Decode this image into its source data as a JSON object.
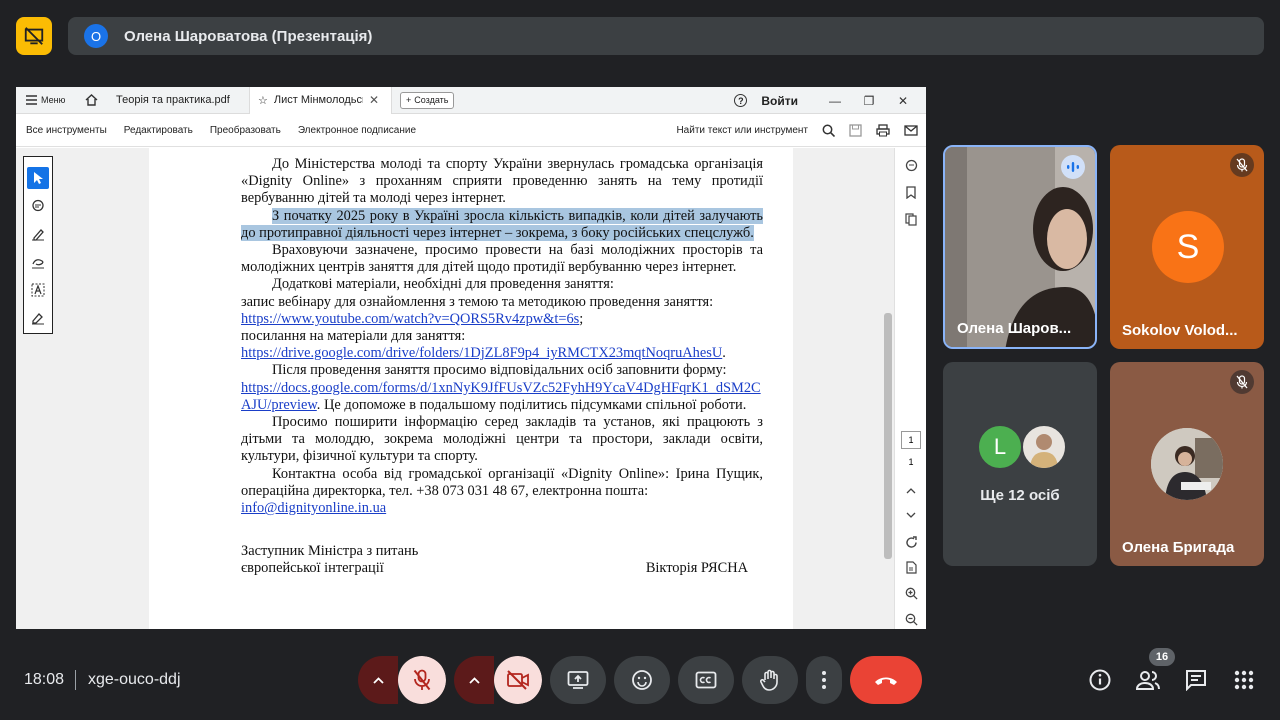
{
  "presenter": {
    "avatar_letter": "О",
    "title": "Олена Шароватова (Презентація)",
    "stop_icon": "presentation-off-icon"
  },
  "reader": {
    "menu_label": "Меню",
    "tabs": [
      {
        "label": "Теорія та практика.pdf"
      },
      {
        "label": "Лист Мінмолодьспо..."
      }
    ],
    "create_label": "Создать",
    "signin_label": "Войти",
    "toolbar": {
      "all_tools": "Все инструменты",
      "edit": "Редактировать",
      "convert": "Преобразовать",
      "esign": "Электронное подписание",
      "find": "Найти текст или инструмент"
    },
    "page_current": "1",
    "page_total": "1"
  },
  "doc": {
    "p1": "До Міністерства молоді та спорту України звернулась громадська організація «Dignity Online» з проханням сприяти проведенню занять на тему протидії вербуванню дітей та молоді через інтернет.",
    "p2": "З початку 2025 року в Україні зросла кількість випадків, коли дітей залучають до протиправної діяльності через інтернет – зокрема, з боку російських спецслужб.",
    "p3": "Враховуючи зазначене, просимо провести на базі молодіжних просторів та молодіжних центрів заняття для дітей щодо протидії вербуванню через інтернет.",
    "p4": "Додаткові матеріали, необхідні для проведення заняття:",
    "p5": "запис вебінару для ознайомлення з темою та методикою проведення заняття:",
    "link1": "https://www.youtube.com/watch?v=QORS5Rv4zpw&t=6s",
    "p5_end": ";",
    "p6": "посилання на матеріали для заняття:",
    "link2": "https://drive.google.com/drive/folders/1DjZL8F9p4_iyRMCTX23mqtNoqruAhesU",
    "p6_end": ".",
    "p7": "Після проведення заняття просимо відповідальних осіб заповнити форму:",
    "link3": "https://docs.google.com/forms/d/1xnNyK9JfFUsVZc52FyhH9YcaV4DgHFqrK1_dSM2CAJU/preview",
    "p7_end": ". Це допоможе в подальшому поділитись підсумками спільної роботи.",
    "p8": "Просимо поширити інформацію серед закладів та установ, які працюють з дітьми та молоддю, зокрема молодіжні центри та простори, заклади освіти, культури, фізичної культури та спорту.",
    "p9": "Контактна особа від громадської організації «Dignity Online»: Ірина Пущик, операційна директорка, тел. +38 073 031 48 67, електронна пошта:",
    "email": "info@dignityonline.in.ua",
    "sig_line1": "Заступник Міністра з питань",
    "sig_line2": "європейської інтеграції",
    "sig_name": "Вікторія РЯСНА"
  },
  "participants": [
    {
      "name": "Олена Шаров...",
      "speaking": true
    },
    {
      "name": "Sokolov Volod...",
      "avatar_letter": "S",
      "muted": true
    },
    {
      "others_letter": "L",
      "others_label": "Ще 12 осіб"
    },
    {
      "name": "Олена Бригада",
      "muted": true
    }
  ],
  "bottom": {
    "time": "18:08",
    "meeting_code": "xge-ouco-ddj",
    "people_count": "16"
  },
  "colors": {
    "accent_blue": "#1a73e8",
    "hangup_red": "#ea4335",
    "presenting_yellow": "#fbbc04",
    "avatar_orange": "#f97316",
    "avatar_green": "#4caf50"
  }
}
